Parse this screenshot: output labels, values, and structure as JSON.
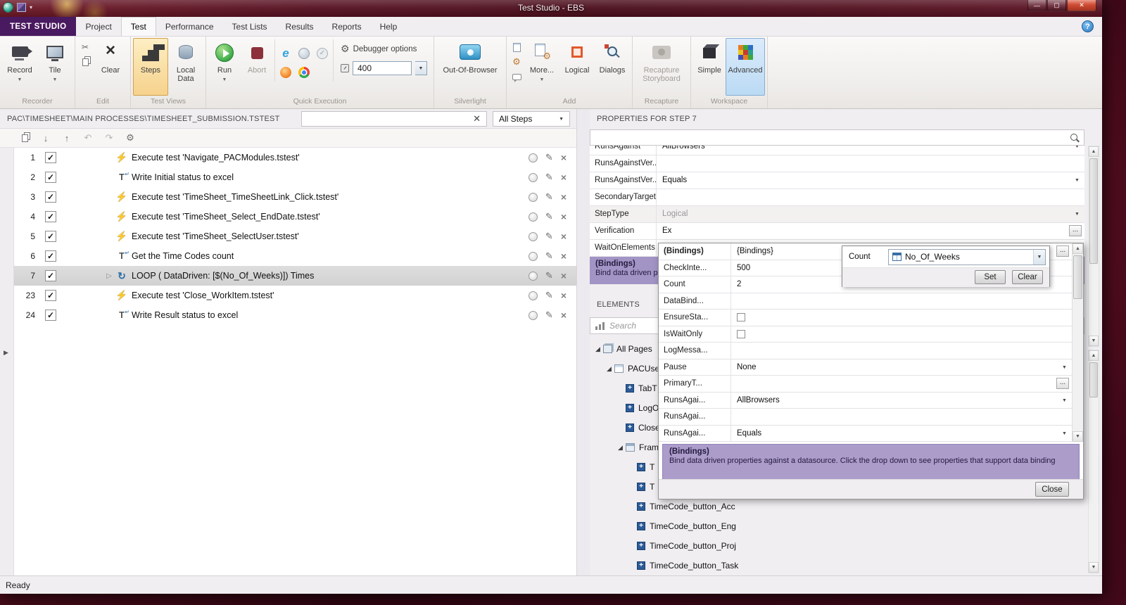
{
  "window": {
    "title": "Test Studio - EBS",
    "status": "Ready"
  },
  "menubar": {
    "app_tab": "TEST STUDIO",
    "tabs": [
      {
        "label": "Project",
        "active": false
      },
      {
        "label": "Test",
        "active": true
      },
      {
        "label": "Performance",
        "active": false
      },
      {
        "label": "Test Lists",
        "active": false
      },
      {
        "label": "Results",
        "active": false
      },
      {
        "label": "Reports",
        "active": false
      },
      {
        "label": "Help",
        "active": false
      }
    ]
  },
  "ribbon": {
    "recorder": {
      "group": "Recorder",
      "record": "Record",
      "tile": "Tile"
    },
    "edit": {
      "group": "Edit",
      "clear": "Clear"
    },
    "test_views": {
      "group": "Test Views",
      "steps": "Steps",
      "local_data": "Local Data"
    },
    "quick_execution": {
      "group": "Quick Execution",
      "run": "Run",
      "abort": "Abort",
      "debugger_options": "Debugger options",
      "speed": "400"
    },
    "silverlight": {
      "group": "Silverlight",
      "out_of_browser": "Out-Of-Browser"
    },
    "add": {
      "group": "Add",
      "more": "More...",
      "logical": "Logical",
      "dialogs": "Dialogs"
    },
    "recapture": {
      "group": "Recapture",
      "button": "Recapture Storyboard"
    },
    "workspace": {
      "group": "Workspace",
      "simple": "Simple",
      "advanced": "Advanced"
    }
  },
  "steps_panel": {
    "path": "PAC\\TIMESHEET\\MAIN PROCESSES\\TIMESHEET_SUBMISSION.TSTEST",
    "filter_value": "All Steps",
    "rows": [
      {
        "num": "1",
        "checked": true,
        "icon": "execute",
        "text": "Execute test 'Navigate_PACModules.tstest'"
      },
      {
        "num": "2",
        "checked": true,
        "icon": "coded",
        "text": "Write Initial status to  excel"
      },
      {
        "num": "3",
        "checked": true,
        "icon": "execute",
        "text": "Execute test 'TimeSheet_TimeSheetLink_Click.tstest'"
      },
      {
        "num": "4",
        "checked": true,
        "icon": "execute",
        "text": "Execute test 'TimeSheet_Select_EndDate.tstest'"
      },
      {
        "num": "5",
        "checked": true,
        "icon": "execute",
        "text": "Execute test 'TimeSheet_SelectUser.tstest'"
      },
      {
        "num": "6",
        "checked": true,
        "icon": "coded",
        "text": "Get the Time Codes count"
      },
      {
        "num": "7",
        "checked": true,
        "icon": "loop",
        "text": "LOOP ( DataDriven: [$(No_Of_Weeks)]) Times",
        "selected": true,
        "expandable": true
      },
      {
        "num": "23",
        "checked": true,
        "icon": "execute",
        "text": "Execute test 'Close_WorkItem.tstest'"
      },
      {
        "num": "24",
        "checked": true,
        "icon": "coded",
        "text": "Write Result status to excel"
      }
    ]
  },
  "properties_panel": {
    "title": "PROPERTIES FOR STEP 7",
    "rows": [
      {
        "label": "RunsAgainst",
        "value": "AllBrowsers",
        "rtype": "dropdown"
      },
      {
        "label": "RunsAgainstVer...",
        "value": "",
        "rtype": "text"
      },
      {
        "label": "RunsAgainstVer...",
        "value": "Equals",
        "rtype": "dropdown"
      },
      {
        "label": "SecondaryTarget",
        "value": "",
        "rtype": "text"
      },
      {
        "label": "StepType",
        "value": "Logical",
        "rtype": "dropdown",
        "disabled": true
      },
      {
        "label": "Verification",
        "value": "Ex",
        "rtype": "ellipsis"
      },
      {
        "label": "WaitOnElements",
        "value": "",
        "rtype": "dropdown-left"
      }
    ],
    "bindings_band": {
      "title": "(Bindings)",
      "text": "Bind data driven prop"
    }
  },
  "elements_panel": {
    "title": "ELEMENTS",
    "search_placeholder": "Search",
    "tree": [
      {
        "label": "All Pages",
        "level": 0,
        "expanded": true,
        "icon": "pages"
      },
      {
        "label": "PACUser",
        "level": 1,
        "expanded": true,
        "icon": "page"
      },
      {
        "label": "TabT",
        "level": 2,
        "icon": "element"
      },
      {
        "label": "LogO",
        "level": 2,
        "icon": "element"
      },
      {
        "label": "Close",
        "level": 2,
        "icon": "element"
      },
      {
        "label": "Fram",
        "level": 2,
        "expanded": true,
        "icon": "frame"
      },
      {
        "label": "T",
        "level": 3,
        "icon": "element"
      },
      {
        "label": "T",
        "level": 3,
        "icon": "element"
      },
      {
        "label": "TimeCode_button_Acc",
        "level": 3,
        "icon": "element"
      },
      {
        "label": "TimeCode_button_Eng",
        "level": 3,
        "icon": "element"
      },
      {
        "label": "TimeCode_button_Proj",
        "level": 3,
        "icon": "element"
      },
      {
        "label": "TimeCode_button_Task",
        "level": 3,
        "icon": "element"
      }
    ]
  },
  "popup": {
    "rows": [
      {
        "label": "(Bindings)",
        "value": "{Bindings}",
        "rtype": "ellipsis",
        "bold": true
      },
      {
        "label": "CheckInte...",
        "value": "500",
        "rtype": "text"
      },
      {
        "label": "Count",
        "value": "2",
        "rtype": "text"
      },
      {
        "label": "DataBind...",
        "value": "",
        "rtype": "text"
      },
      {
        "label": "EnsureSta...",
        "value": "",
        "rtype": "checkbox"
      },
      {
        "label": "IsWaitOnly",
        "value": "",
        "rtype": "checkbox"
      },
      {
        "label": "LogMessa...",
        "value": "",
        "rtype": "text"
      },
      {
        "label": "Pause",
        "value": "None",
        "rtype": "dropdown"
      },
      {
        "label": "PrimaryT...",
        "value": "",
        "rtype": "ellipsis"
      },
      {
        "label": "RunsAgai...",
        "value": "AllBrowsers",
        "rtype": "dropdown"
      },
      {
        "label": "RunsAgai...",
        "value": "",
        "rtype": "text"
      },
      {
        "label": "RunsAgai...",
        "value": "Equals",
        "rtype": "dropdown"
      }
    ],
    "info_title": "(Bindings)",
    "info_text": "Bind data driven properties against a datasource. Click the drop down to see properties that support data binding",
    "close_label": "Close"
  },
  "count_popup": {
    "label": "Count",
    "value": "No_Of_Weeks",
    "set_label": "Set",
    "clear_label": "Clear"
  }
}
